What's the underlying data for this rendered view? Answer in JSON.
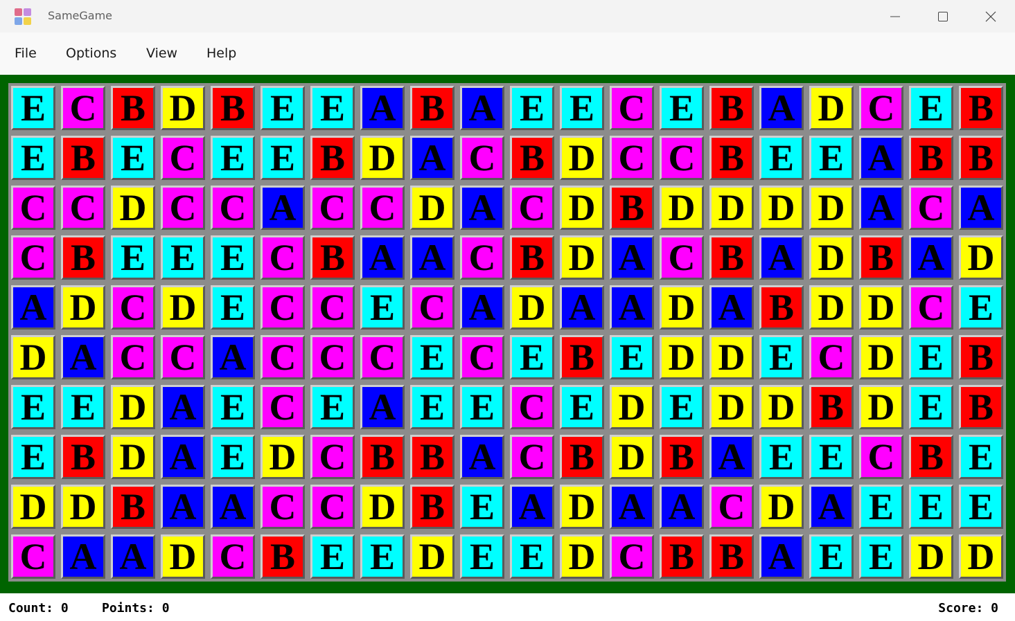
{
  "window": {
    "title": "SameGame",
    "app_icon": "samegame-app-icon",
    "controls": [
      "minimize-icon",
      "maximize-icon",
      "close-icon"
    ]
  },
  "menu": [
    {
      "label": "File"
    },
    {
      "label": "Options"
    },
    {
      "label": "View"
    },
    {
      "label": "Help"
    }
  ],
  "board": {
    "background": "#006400",
    "colors": {
      "A": "#0000ff",
      "B": "#ff0000",
      "C": "#ff00ff",
      "D": "#ffff00",
      "E": "#00ffff"
    },
    "rows": [
      "ECBDBEEABAEECEBADCEB",
      "EBECEEBDACBDCCBEEABB",
      "CCDCCACCDACDBDDDDACA",
      "CBEEECBAACBDACBADBAD",
      "ADCDECCECADAADABDDCE",
      "DACCACCCECEBEDDECDEB",
      "EEDAECEAEECEDEDDBDEB",
      "EBDAEDCBBACBDBAEECBE",
      "DDBAACCDBEADAACDAEEE",
      "CAADCBEEDEEDCBBAEEDD"
    ]
  },
  "status": {
    "count": "Count: 0",
    "points": "Points: 0",
    "score": "Score: 0"
  }
}
